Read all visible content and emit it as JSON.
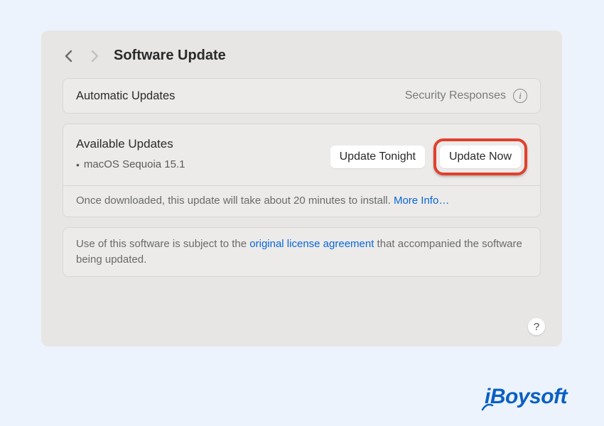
{
  "header": {
    "title": "Software Update"
  },
  "automatic_updates": {
    "label": "Automatic Updates",
    "detail": "Security Responses"
  },
  "available": {
    "title": "Available Updates",
    "item": "macOS Sequoia 15.1",
    "tonight_label": "Update Tonight",
    "now_label": "Update Now",
    "note_prefix": "Once downloaded, this update will take about 20 minutes to install. ",
    "more_info": "More Info…"
  },
  "license": {
    "prefix": "Use of this software is subject to the ",
    "link": "original license agreement",
    "suffix": " that accompanied the software being updated."
  },
  "help": "?",
  "watermark": "iBoysoft"
}
